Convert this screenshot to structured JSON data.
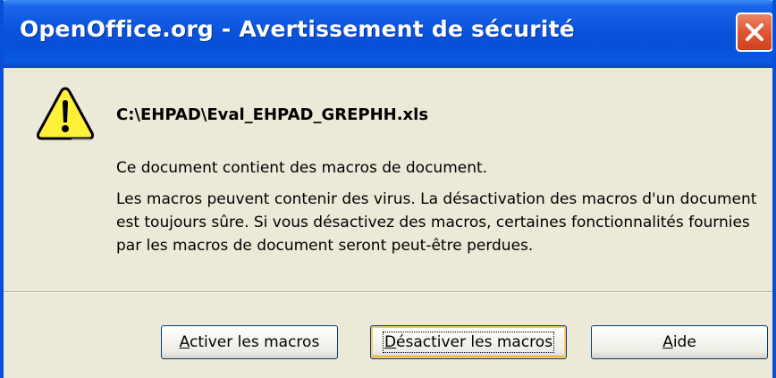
{
  "window": {
    "title": "OpenOffice.org - Avertissement de sécurité",
    "close_icon": "close-icon",
    "accent_color": "#0a54dd"
  },
  "dialog": {
    "icon": "warning-icon",
    "file_path": "C:\\EHPAD\\Eval_EHPAD_GREPHH.xls",
    "message_primary": "Ce document contient des macros de document.",
    "message_secondary": "Les macros peuvent contenir des virus. La désactivation des macros d'un document est toujours sûre. Si vous désactivez des macros, certaines fonctionnalités fournies par les macros de document seront peut-être perdues."
  },
  "buttons": {
    "activate": {
      "label": "Activer les macros",
      "mnemonic": "A"
    },
    "deactivate": {
      "label": "Désactiver les macros",
      "mnemonic": "D"
    },
    "help": {
      "label": "Aide",
      "mnemonic": "A"
    }
  }
}
